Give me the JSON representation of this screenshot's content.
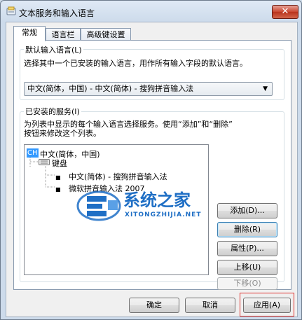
{
  "window": {
    "title": "文本服务和输入语言",
    "minimize": "—",
    "maximize": "□",
    "close": "✕"
  },
  "tabs": [
    {
      "label": "常规"
    },
    {
      "label": "语言栏"
    },
    {
      "label": "高级键设置"
    }
  ],
  "default_language": {
    "group_label": "默认输入语言(L)",
    "description": "选择其中一个已安装的输入语言，用作所有输入字段的默认语言。",
    "selected": "中文(简体，中国) - 中文(简体) - 搜狗拼音输入法"
  },
  "installed_services": {
    "group_label": "已安装的服务(I)",
    "description_line1": "为列表中显示的每个输入语言选择服务。使用“添加”和“删除”",
    "description_line2": "按钮来修改这个列表。",
    "tree": {
      "lang_badge": "CH",
      "language": "中文(简体，中国)",
      "category": "键盘",
      "items": [
        "中文(简体) - 搜狗拼音输入法",
        "微软拼音输入法 2007"
      ]
    },
    "buttons": {
      "add": "添加(D)...",
      "remove": "删除(R)",
      "properties": "属性(P)...",
      "move_up": "上移(U)",
      "move_down": "下移(O)"
    }
  },
  "footer": {
    "ok": "确定",
    "cancel": "取消",
    "apply": "应用(A)"
  },
  "watermark": {
    "brand": "系统之家",
    "url": "XITONGZHIJIA.NET"
  },
  "colors": {
    "highlight": "#3399ff",
    "apply_outline": "#e0332f",
    "watermark_blue": "#1f6fc5"
  }
}
